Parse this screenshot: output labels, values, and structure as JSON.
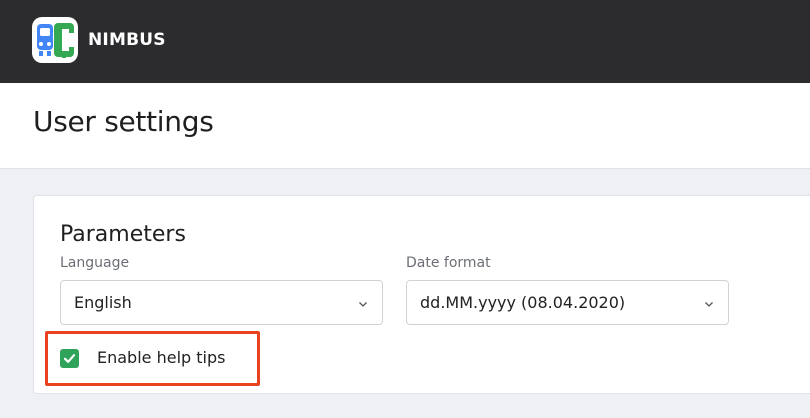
{
  "app": {
    "brand_name": "NIMBUS",
    "logo_icon": "nimbus-logo",
    "colors": {
      "topbar": "#2c2c2e",
      "logo_blue": "#4285f4",
      "logo_green": "#34a853",
      "accent_green": "#2fa35a",
      "highlight": "#e8431f"
    }
  },
  "page": {
    "title": "User settings"
  },
  "parameters": {
    "section_title": "Parameters",
    "language": {
      "label": "Language",
      "value": "English",
      "icon": "chevron-down-icon"
    },
    "date_format": {
      "label": "Date format",
      "value": "dd.MM.yyyy (08.04.2020)",
      "icon": "chevron-down-icon"
    },
    "help_tips": {
      "label": "Enable help tips",
      "checked": true,
      "icon": "checkmark-icon"
    }
  }
}
